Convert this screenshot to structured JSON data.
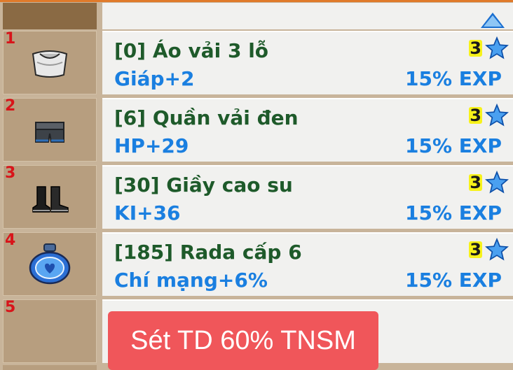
{
  "header": {
    "scroll_up": "up-arrow-icon"
  },
  "items": [
    {
      "slot": "1",
      "icon": "shirt-icon",
      "name": "[0] Áo vải 3 lỗ",
      "stat": "Giáp+2",
      "exp": "15% EXP",
      "stars": "3",
      "star_icon": "star-icon"
    },
    {
      "slot": "2",
      "icon": "shorts-icon",
      "name": "[6] Quần vải đen",
      "stat": "HP+29",
      "exp": "15% EXP",
      "stars": "3",
      "star_icon": "star-icon"
    },
    {
      "slot": "3",
      "icon": "boots-icon",
      "name": "[30] Giầy cao su",
      "stat": "KI+36",
      "exp": "15% EXP",
      "stars": "3",
      "star_icon": "star-icon"
    },
    {
      "slot": "4",
      "icon": "radar-icon",
      "name": "[185] Rada cấp 6",
      "stat": "Chí mạng+6%",
      "exp": "15% EXP",
      "stars": "3",
      "star_icon": "star-icon"
    },
    {
      "slot": "5"
    }
  ],
  "banner": {
    "text": "Sét TD 60% TNSM"
  },
  "colors": {
    "slot_number": "#d8141a",
    "item_name": "#1e5a2a",
    "stat": "#1a7fe0",
    "banner": "#f0565a"
  }
}
